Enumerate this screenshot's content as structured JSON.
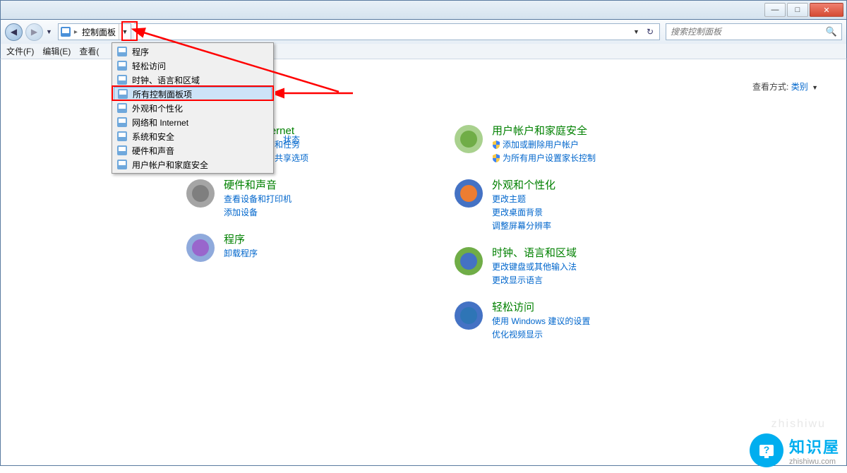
{
  "titlebar": {
    "min": "—",
    "max": "□",
    "close": "✕"
  },
  "nav": {
    "address": "控制面板",
    "search_placeholder": "搜索控制面板"
  },
  "menu": {
    "file": "文件(F)",
    "edit": "编辑(E)",
    "view": "查看("
  },
  "viewmode": {
    "label": "查看方式:",
    "value": "类别"
  },
  "dropdown": {
    "items": [
      {
        "icon": "app",
        "label": "程序"
      },
      {
        "icon": "ease",
        "label": "轻松访问"
      },
      {
        "icon": "clock",
        "label": "时钟、语言和区域"
      },
      {
        "icon": "panel",
        "label": "所有控制面板项"
      },
      {
        "icon": "appear",
        "label": "外观和个性化"
      },
      {
        "icon": "net",
        "label": "网络和 Internet"
      },
      {
        "icon": "sec",
        "label": "系统和安全"
      },
      {
        "icon": "sound",
        "label": "硬件和声音"
      },
      {
        "icon": "user",
        "label": "用户帐户和家庭安全"
      }
    ],
    "highlighted_index": 3
  },
  "status_text": "状态",
  "categories": {
    "left": [
      {
        "title": "网络和 Internet",
        "links": [
          "查看网络状态和任务",
          "选择家庭组和共享选项"
        ],
        "shields": []
      },
      {
        "title": "硬件和声音",
        "links": [
          "查看设备和打印机",
          "添加设备"
        ],
        "shields": []
      },
      {
        "title": "程序",
        "links": [
          "卸载程序"
        ],
        "shields": []
      }
    ],
    "right": [
      {
        "title": "用户帐户和家庭安全",
        "links": [
          "添加或删除用户帐户",
          "为所有用户设置家长控制"
        ],
        "shields": [
          0,
          1
        ]
      },
      {
        "title": "外观和个性化",
        "links": [
          "更改主题",
          "更改桌面背景",
          "调整屏幕分辨率"
        ],
        "shields": []
      },
      {
        "title": "时钟、语言和区域",
        "links": [
          "更改键盘或其他输入法",
          "更改显示语言"
        ],
        "shields": []
      },
      {
        "title": "轻松访问",
        "links": [
          "使用 Windows 建议的设置",
          "优化视频显示"
        ],
        "shields": []
      }
    ]
  },
  "logo": {
    "text": "知识屋",
    "url": "zhishiwu.com"
  }
}
